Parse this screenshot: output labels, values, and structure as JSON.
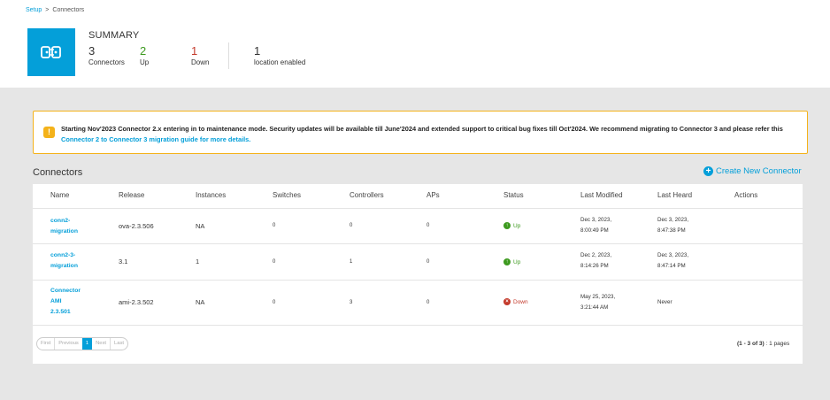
{
  "breadcrumb": {
    "parent": "Setup",
    "separator": ">",
    "current": "Connectors"
  },
  "summary": {
    "title": "SUMMARY",
    "stats": [
      {
        "value": "3",
        "label": "Connectors",
        "color": "#333333"
      },
      {
        "value": "2",
        "label": "Up",
        "color": "#3d9a1f"
      },
      {
        "value": "1",
        "label": "Down",
        "color": "#c43a2b"
      },
      {
        "value": "1",
        "label": "location enabled",
        "color": "#333333"
      }
    ],
    "tile_icon": "connector-plug-icon",
    "tile_color": "#049fd9"
  },
  "banner": {
    "icon": "warning-icon",
    "text": "Starting Nov'2023 Connector 2.x entering in to maintenance mode. Security updates will be available till June'2024 and extended support to critical bug fixes till Oct'2024. We recommend migrating to Connector 3 and please refer this ",
    "link": "Connector 2 to Connector 3 migration guide for more details.",
    "border_color": "#f4b21a"
  },
  "section": {
    "title": "Connectors",
    "create_label": "Create New Connector"
  },
  "table": {
    "columns": [
      "Name",
      "Release",
      "Instances",
      "Switches",
      "Controllers",
      "APs",
      "Status",
      "Last Modified",
      "Last Heard",
      "Actions"
    ],
    "rows": [
      {
        "name": [
          "conn2-",
          "migration"
        ],
        "release": "ova-2.3.506",
        "instances": "NA",
        "switches": "0",
        "controllers": "0",
        "aps": "0",
        "status": "Up",
        "modified": [
          "Dec 3, 2023,",
          "8:00:49 PM"
        ],
        "heard": [
          "Dec 3, 2023,",
          "8:47:38 PM"
        ]
      },
      {
        "name": [
          "conn2-3-",
          "migration"
        ],
        "release": "3.1",
        "instances": "1",
        "switches": "0",
        "controllers": "1",
        "aps": "0",
        "status": "Up",
        "modified": [
          "Dec 2, 2023,",
          "8:14:26 PM"
        ],
        "heard": [
          "Dec 3, 2023,",
          "8:47:14 PM"
        ]
      },
      {
        "name": [
          "Connector",
          "AMI",
          "2.3.501"
        ],
        "release": "ami-2.3.502",
        "instances": "NA",
        "switches": "0",
        "controllers": "3",
        "aps": "0",
        "status": "Down",
        "modified": [
          "May 25, 2023,",
          "3:21:44 AM"
        ],
        "heard": [
          "Never"
        ]
      }
    ]
  },
  "pagination": {
    "first": "First",
    "previous": "Previous",
    "current": "1",
    "next": "Next",
    "last": "Last",
    "info_bold": "(1 - 3 of 3)",
    "info_rest": " : 1 pages"
  }
}
